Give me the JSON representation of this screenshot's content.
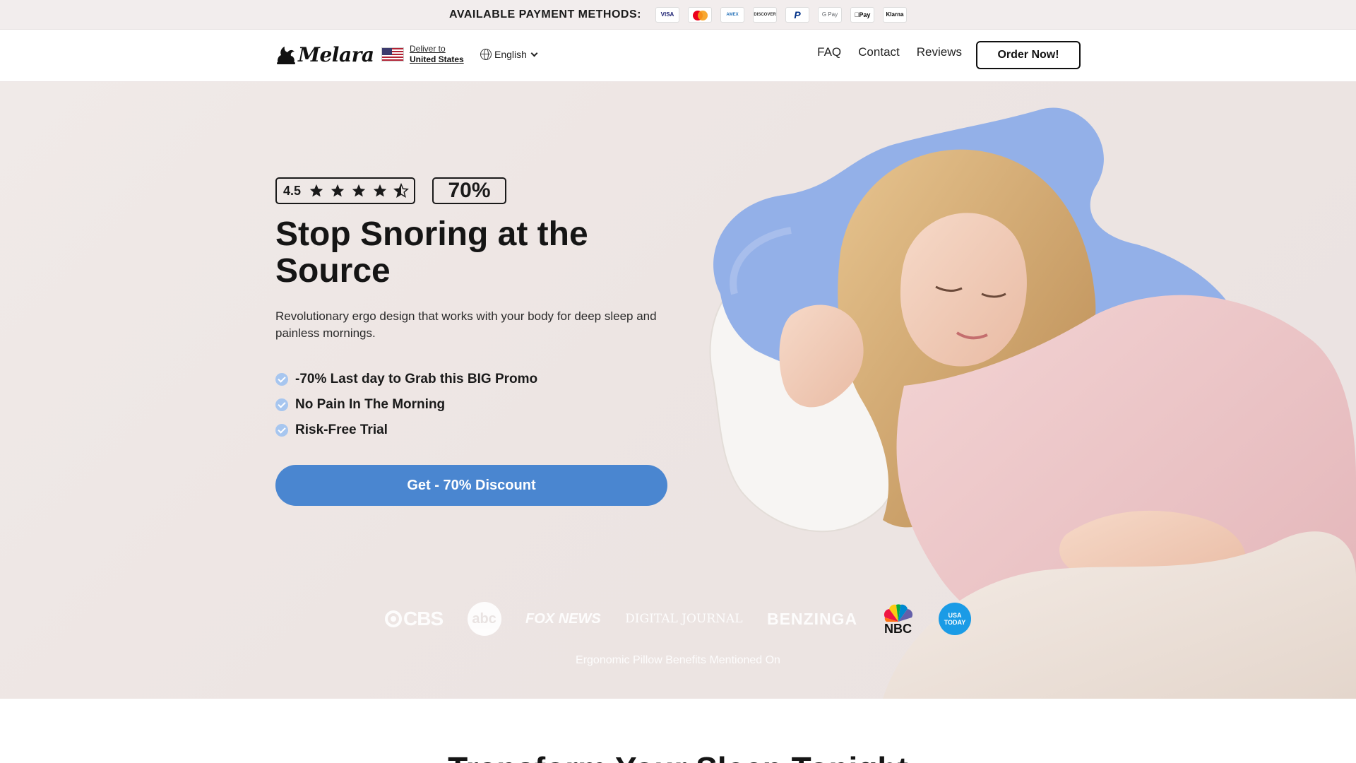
{
  "paybar": {
    "label": "AVAILABLE PAYMENT METHODS:",
    "methods": [
      "VISA",
      "Mastercard",
      "AMERICAN EXPRESS",
      "DISCOVER",
      "PayPal",
      "G Pay",
      "Apple Pay",
      "Klarna"
    ]
  },
  "header": {
    "logo": "Melara",
    "deliver_top": "Deliver to",
    "deliver_bottom": "United States",
    "language": "English",
    "nav": [
      "FAQ",
      "Contact",
      "Reviews"
    ],
    "order_button": "Order Now!"
  },
  "hero": {
    "rating": "4.5",
    "stars": 4.5,
    "discount_badge": "70%",
    "title": "Stop Snoring at the Source",
    "subtitle": "Revolutionary ergo design that works with your body for deep sleep and painless mornings.",
    "bullets": [
      "-70% Last day to Grab this BIG Promo",
      "No Pain In The Morning",
      "Risk-Free Trial"
    ],
    "cta": "Get - 70% Discount",
    "press_logos": [
      "CBS",
      "abc",
      "FOX NEWS",
      "DIGITAL JOURNAL",
      "BENZINGA",
      "NBC",
      "USA TODAY"
    ],
    "press_caption": "Ergonomic Pillow Benefits Mentioned On"
  },
  "colors": {
    "accent": "#4a86d0",
    "check": "#a7c6ef",
    "hero_bg": "#ede5e3"
  },
  "next_section": {
    "title_partial": "Transform Your Sleep Tonight"
  }
}
